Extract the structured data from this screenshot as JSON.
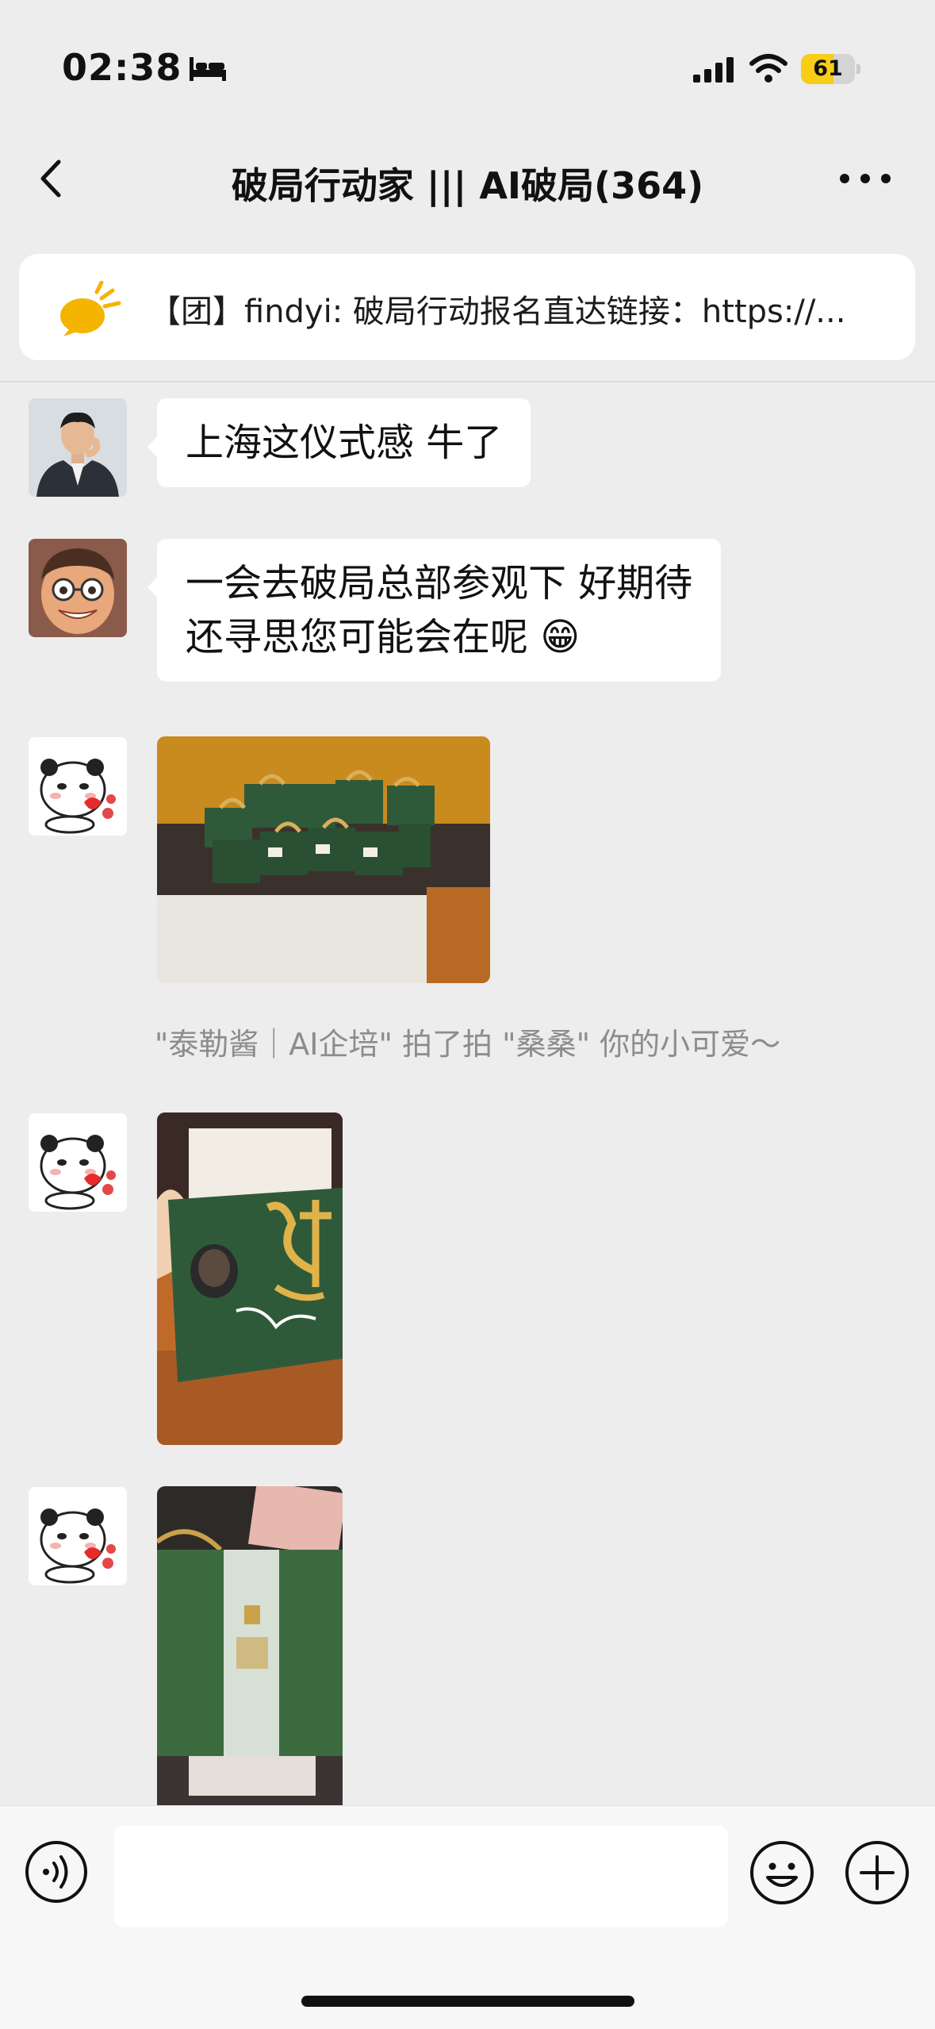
{
  "status_bar": {
    "time": "02:38",
    "focus_icon": "bed-icon",
    "battery_level": "61",
    "battery_fraction": 0.61
  },
  "nav": {
    "title": "破局行动家 ||| AI破局(364)",
    "back_icon": "chevron-left-icon",
    "more_icon": "more-dots-icon"
  },
  "pinned": {
    "icon": "announcement-icon",
    "text": "【团】findyi: 破局行动报名直达链接：https://..."
  },
  "messages": [
    {
      "type": "text",
      "avatar": "avatar-man-suit",
      "text_lines": [
        "上海这仪式感 牛了"
      ]
    },
    {
      "type": "text",
      "avatar": "avatar-cartoon-man",
      "text_lines": [
        "一会去破局总部参观下 好期待",
        "还寻思您可能会在呢 😁"
      ]
    },
    {
      "type": "image",
      "avatar": "avatar-panda-sticker",
      "image": "photo-green-gift-boxes-pile"
    },
    {
      "type": "system",
      "text": "\"泰勒酱｜AI企培\" 拍了拍 \"桑桑\" 你的小可爱～"
    },
    {
      "type": "image",
      "avatar": "avatar-panda-sticker",
      "image": "photo-green-gift-box-card"
    },
    {
      "type": "image",
      "avatar": "avatar-panda-sticker",
      "image": "photo-green-gift-bag"
    }
  ],
  "input_bar": {
    "voice_icon": "voice-icon",
    "input_value": "",
    "emoji_icon": "emoji-icon",
    "plus_icon": "plus-icon"
  },
  "colors": {
    "background": "#ededed",
    "bubble": "#ffffff",
    "battery_accent": "#f7cd15",
    "announce_accent": "#f5b400"
  }
}
